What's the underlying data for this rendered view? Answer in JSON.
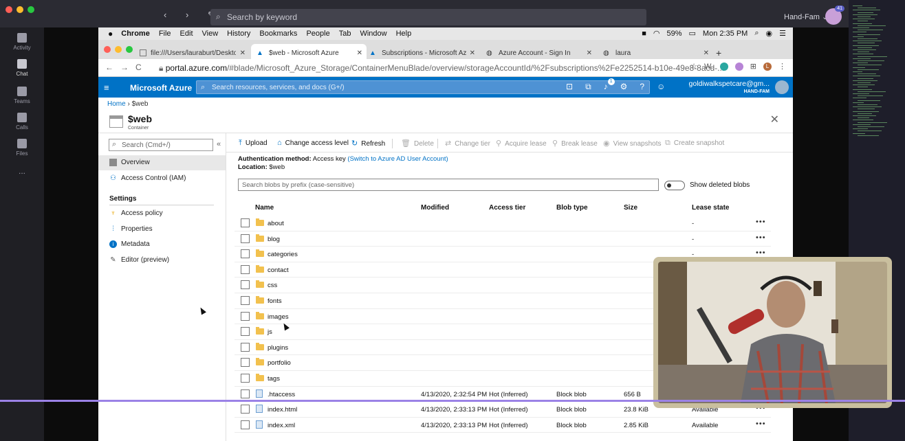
{
  "teams": {
    "search_placeholder": "Search by keyword",
    "nav_arrows": "‹ › ✎",
    "user": "Hand-Fam ⌄",
    "badge": "41",
    "rail": [
      {
        "label": "Activity"
      },
      {
        "label": "Chat"
      },
      {
        "label": "Teams"
      },
      {
        "label": "Calls"
      },
      {
        "label": "Files"
      },
      {
        "label": "..."
      }
    ]
  },
  "mac_menu": {
    "items": [
      "Chrome",
      "File",
      "Edit",
      "View",
      "History",
      "Bookmarks",
      "People",
      "Tab",
      "Window",
      "Help"
    ],
    "battery": "59%",
    "clock": "Mon 2:35 PM"
  },
  "chrome": {
    "tabs": [
      {
        "label": "file:///Users/lauraburt/Desktop"
      },
      {
        "label": "$web - Microsoft Azure"
      },
      {
        "label": "Subscriptions - Microsoft Azur"
      },
      {
        "label": "Azure Account - Sign In"
      },
      {
        "label": "laura"
      }
    ],
    "url_host": "portal.azure.com",
    "url_path": "/#blade/Microsoft_Azure_Storage/ContainerMenuBlade/overview/storageAccountId/%2Fsubscriptions%2Fe2252514-b10e-49e8-8acd-...",
    "profile_initial": "L"
  },
  "azure": {
    "brand": "Microsoft Azure",
    "search_placeholder": "Search resources, services, and docs (G+/)",
    "notification_count": "1",
    "account_email": "goldiwalkspetcare@gm...",
    "account_tenant": "HAND-FAM"
  },
  "breadcrumb": {
    "home": "Home",
    "current": "$web"
  },
  "resource": {
    "title": "$web",
    "subtitle": "Container"
  },
  "left_menu": {
    "search_placeholder": "Search (Cmd+/)",
    "items": [
      {
        "label": "Overview"
      },
      {
        "label": "Access Control (IAM)"
      }
    ],
    "section": "Settings",
    "settings_items": [
      {
        "label": "Access policy"
      },
      {
        "label": "Properties"
      },
      {
        "label": "Metadata"
      },
      {
        "label": "Editor (preview)"
      }
    ]
  },
  "toolbar": {
    "upload": "Upload",
    "change_access": "Change access level",
    "refresh": "Refresh",
    "delete": "Delete",
    "change_tier": "Change tier",
    "acquire_lease": "Acquire lease",
    "break_lease": "Break lease",
    "view_snapshots": "View snapshots",
    "create_snapshot": "Create snapshot"
  },
  "auth": {
    "method_label": "Authentication method:",
    "method_value": "Access key",
    "switch_link": "(Switch to Azure AD User Account)",
    "location_label": "Location:",
    "location_value": "$web"
  },
  "blob_search_placeholder": "Search blobs by prefix (case-sensitive)",
  "show_deleted": "Show deleted blobs",
  "columns": {
    "name": "Name",
    "modified": "Modified",
    "access_tier": "Access tier",
    "blob_type": "Blob type",
    "size": "Size",
    "lease_state": "Lease state"
  },
  "rows": [
    {
      "name": "about",
      "kind": "folder",
      "modified": "",
      "tier": "",
      "type": "",
      "size": "",
      "lease": "-"
    },
    {
      "name": "blog",
      "kind": "folder",
      "modified": "",
      "tier": "",
      "type": "",
      "size": "",
      "lease": "-"
    },
    {
      "name": "categories",
      "kind": "folder",
      "modified": "",
      "tier": "",
      "type": "",
      "size": "",
      "lease": "-"
    },
    {
      "name": "contact",
      "kind": "folder",
      "modified": "",
      "tier": "",
      "type": "",
      "size": "",
      "lease": ""
    },
    {
      "name": "css",
      "kind": "folder",
      "modified": "",
      "tier": "",
      "type": "",
      "size": "",
      "lease": ""
    },
    {
      "name": "fonts",
      "kind": "folder",
      "modified": "",
      "tier": "",
      "type": "",
      "size": "",
      "lease": ""
    },
    {
      "name": "images",
      "kind": "folder",
      "modified": "",
      "tier": "",
      "type": "",
      "size": "",
      "lease": ""
    },
    {
      "name": "js",
      "kind": "folder",
      "modified": "",
      "tier": "",
      "type": "",
      "size": "",
      "lease": ""
    },
    {
      "name": "plugins",
      "kind": "folder",
      "modified": "",
      "tier": "",
      "type": "",
      "size": "",
      "lease": ""
    },
    {
      "name": "portfolio",
      "kind": "folder",
      "modified": "",
      "tier": "",
      "type": "",
      "size": "",
      "lease": ""
    },
    {
      "name": "tags",
      "kind": "folder",
      "modified": "",
      "tier": "",
      "type": "",
      "size": "",
      "lease": ""
    },
    {
      "name": ".htaccess",
      "kind": "file",
      "modified": "4/13/2020, 2:32:54 PM",
      "tier": "Hot (Inferred)",
      "type": "Block blob",
      "size": "656 B",
      "lease": ""
    },
    {
      "name": "index.html",
      "kind": "file",
      "modified": "4/13/2020, 2:33:13 PM",
      "tier": "Hot (Inferred)",
      "type": "Block blob",
      "size": "23.8 KiB",
      "lease": "Available"
    },
    {
      "name": "index.xml",
      "kind": "file",
      "modified": "4/13/2020, 2:33:13 PM",
      "tier": "Hot (Inferred)",
      "type": "Block blob",
      "size": "2.85 KiB",
      "lease": "Available"
    }
  ],
  "colors": {
    "azure_blue": "#0072c6",
    "folder": "#f2c14e",
    "overlay_line": "#9b82e6"
  }
}
